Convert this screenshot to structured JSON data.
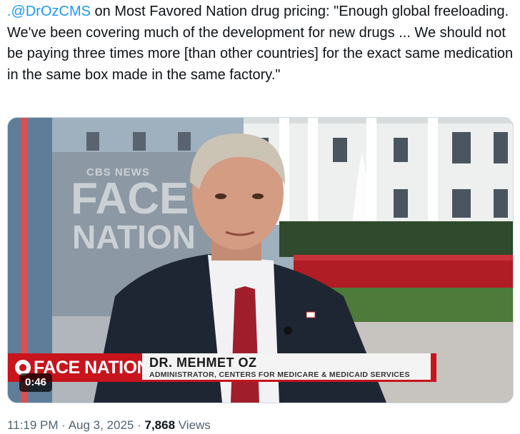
{
  "tweet": {
    "mention": ".@DrOzCMS",
    "text": " on Most Favored Nation drug pricing: \"Enough global freeloading. We've been covering much of the development for new drugs ... We should not be paying three times more [than other countries] for the exact same medication in the same box made in the same factory.\""
  },
  "video": {
    "duration": "0:46",
    "studio_logo": {
      "network": "CBS NEWS",
      "word1": "FACE",
      "word2": "NATION"
    },
    "lower_third": {
      "brand": "FACE NATION",
      "name": "DR. MEHMET OZ",
      "title": "ADMINISTRATOR, CENTERS FOR MEDICARE & MEDICAID SERVICES"
    },
    "colors": {
      "brand_red": "#c8141c"
    }
  },
  "meta": {
    "time": "11:19 PM",
    "separator1": " · ",
    "date": "Aug 3, 2025",
    "separator2": " · ",
    "views_count": "7,868",
    "views_label": " Views"
  }
}
